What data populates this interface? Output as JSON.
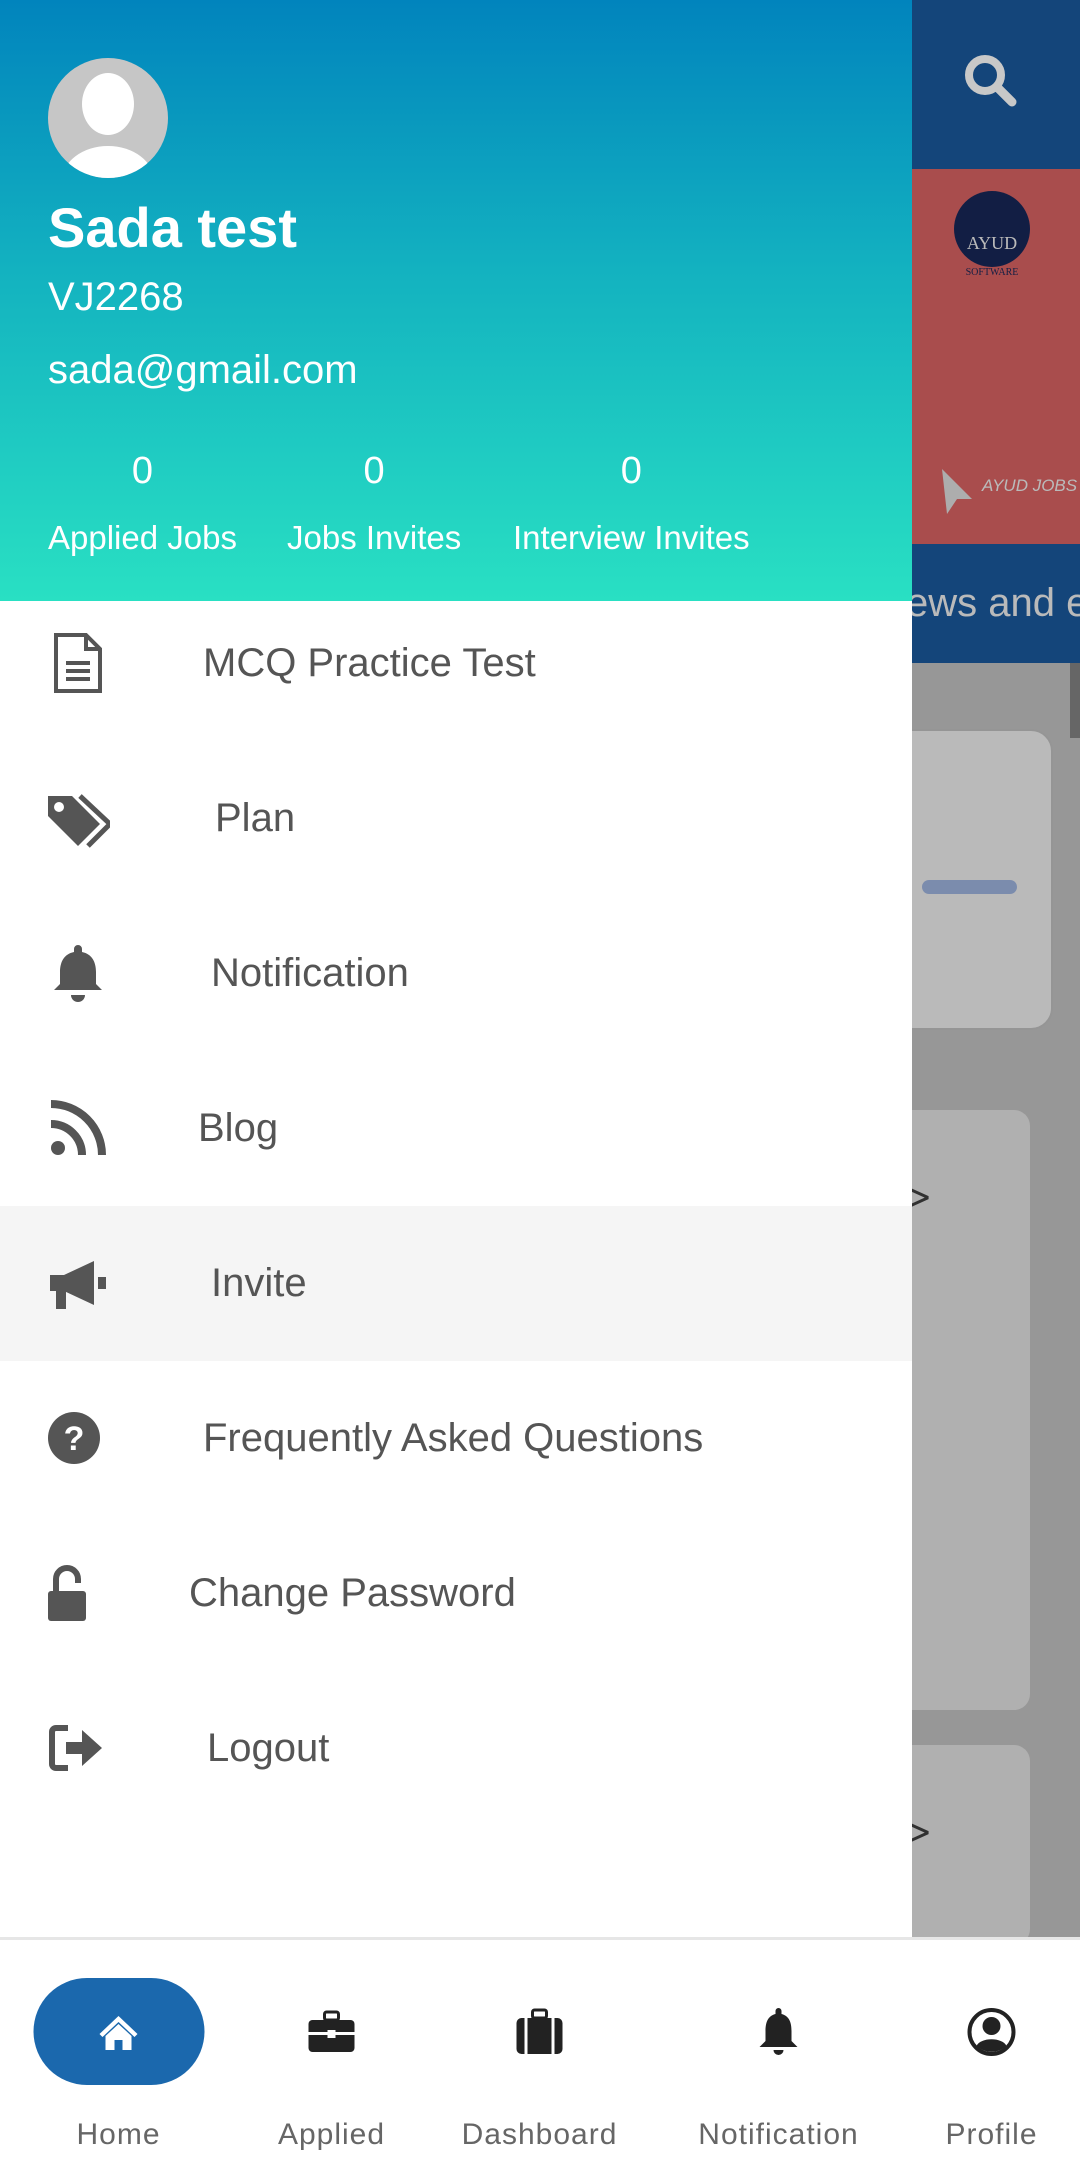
{
  "background": {
    "strip_text": "ews and e",
    "banner_logo_text": [
      "AYUD",
      "SOFTWARE",
      "AYUD JOBS"
    ]
  },
  "drawer": {
    "user": {
      "name": "Sada test",
      "id": "VJ2268",
      "email": "sada@gmail.com"
    },
    "stats": [
      {
        "value": "0",
        "label": "Applied Jobs"
      },
      {
        "value": "0",
        "label": "Jobs Invites"
      },
      {
        "value": "0",
        "label": "Interview Invites"
      }
    ],
    "items": [
      {
        "label": "MCQ Practice Test",
        "icon": "document-icon"
      },
      {
        "label": "Plan",
        "icon": "tags-icon"
      },
      {
        "label": "Notification",
        "icon": "bell-icon"
      },
      {
        "label": "Blog",
        "icon": "rss-icon"
      },
      {
        "label": "Invite",
        "icon": "megaphone-icon",
        "active": true
      },
      {
        "label": "Frequently Asked Questions",
        "icon": "question-circle-icon"
      },
      {
        "label": "Change Password",
        "icon": "unlock-icon"
      },
      {
        "label": "Logout",
        "icon": "sign-out-icon"
      }
    ]
  },
  "bottom_nav": {
    "active": "Home",
    "tabs": [
      {
        "label": "Home",
        "icon": "home-icon"
      },
      {
        "label": "Applied",
        "icon": "briefcase-icon"
      },
      {
        "label": "Dashboard",
        "icon": "suitcase-icon"
      },
      {
        "label": "Notification",
        "icon": "bell-icon"
      },
      {
        "label": "Profile",
        "icon": "user-circle-icon"
      }
    ]
  },
  "colors": {
    "accent": "#1b68ad",
    "header_top": "#0184bd",
    "header_bottom": "#29e0c3",
    "text": "#555555"
  }
}
